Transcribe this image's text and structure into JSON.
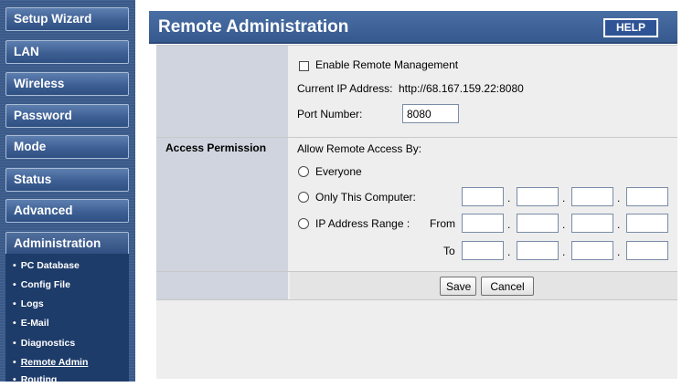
{
  "sidebar": {
    "items": [
      {
        "label": "Setup Wizard"
      },
      {
        "label": "LAN"
      },
      {
        "label": "Wireless"
      },
      {
        "label": "Password"
      },
      {
        "label": "Mode"
      },
      {
        "label": "Status"
      },
      {
        "label": "Advanced"
      },
      {
        "label": "Administration"
      }
    ],
    "submenu": [
      {
        "label": "PC Database"
      },
      {
        "label": "Config File"
      },
      {
        "label": "Logs"
      },
      {
        "label": "E-Mail"
      },
      {
        "label": "Diagnostics"
      },
      {
        "label": "Remote Admin"
      },
      {
        "label": "Routing"
      }
    ],
    "bullet": "•"
  },
  "header": {
    "title": "Remote Administration",
    "help_label": "HELP"
  },
  "form": {
    "enable_label": "Enable Remote Management",
    "enable_checked": false,
    "current_ip_label": "Current IP Address:",
    "current_ip_value": "http://68.167.159.22:8080",
    "port_label": "Port Number:",
    "port_value": "8080",
    "access_heading": "Access Permission",
    "allow_label": "Allow Remote Access By:",
    "options": {
      "everyone": "Everyone",
      "only_this": "Only This Computer:",
      "range": "IP Address Range :"
    },
    "from_label": "From",
    "to_label": "To",
    "ip_separator": ".",
    "save_label": "Save",
    "cancel_label": "Cancel"
  },
  "colors": {
    "sidebar_bg": "#3a5a8a",
    "title_bar": "#4a6fa5",
    "label_cell": "#cfd4de",
    "panel_bg": "#eeeeee"
  }
}
